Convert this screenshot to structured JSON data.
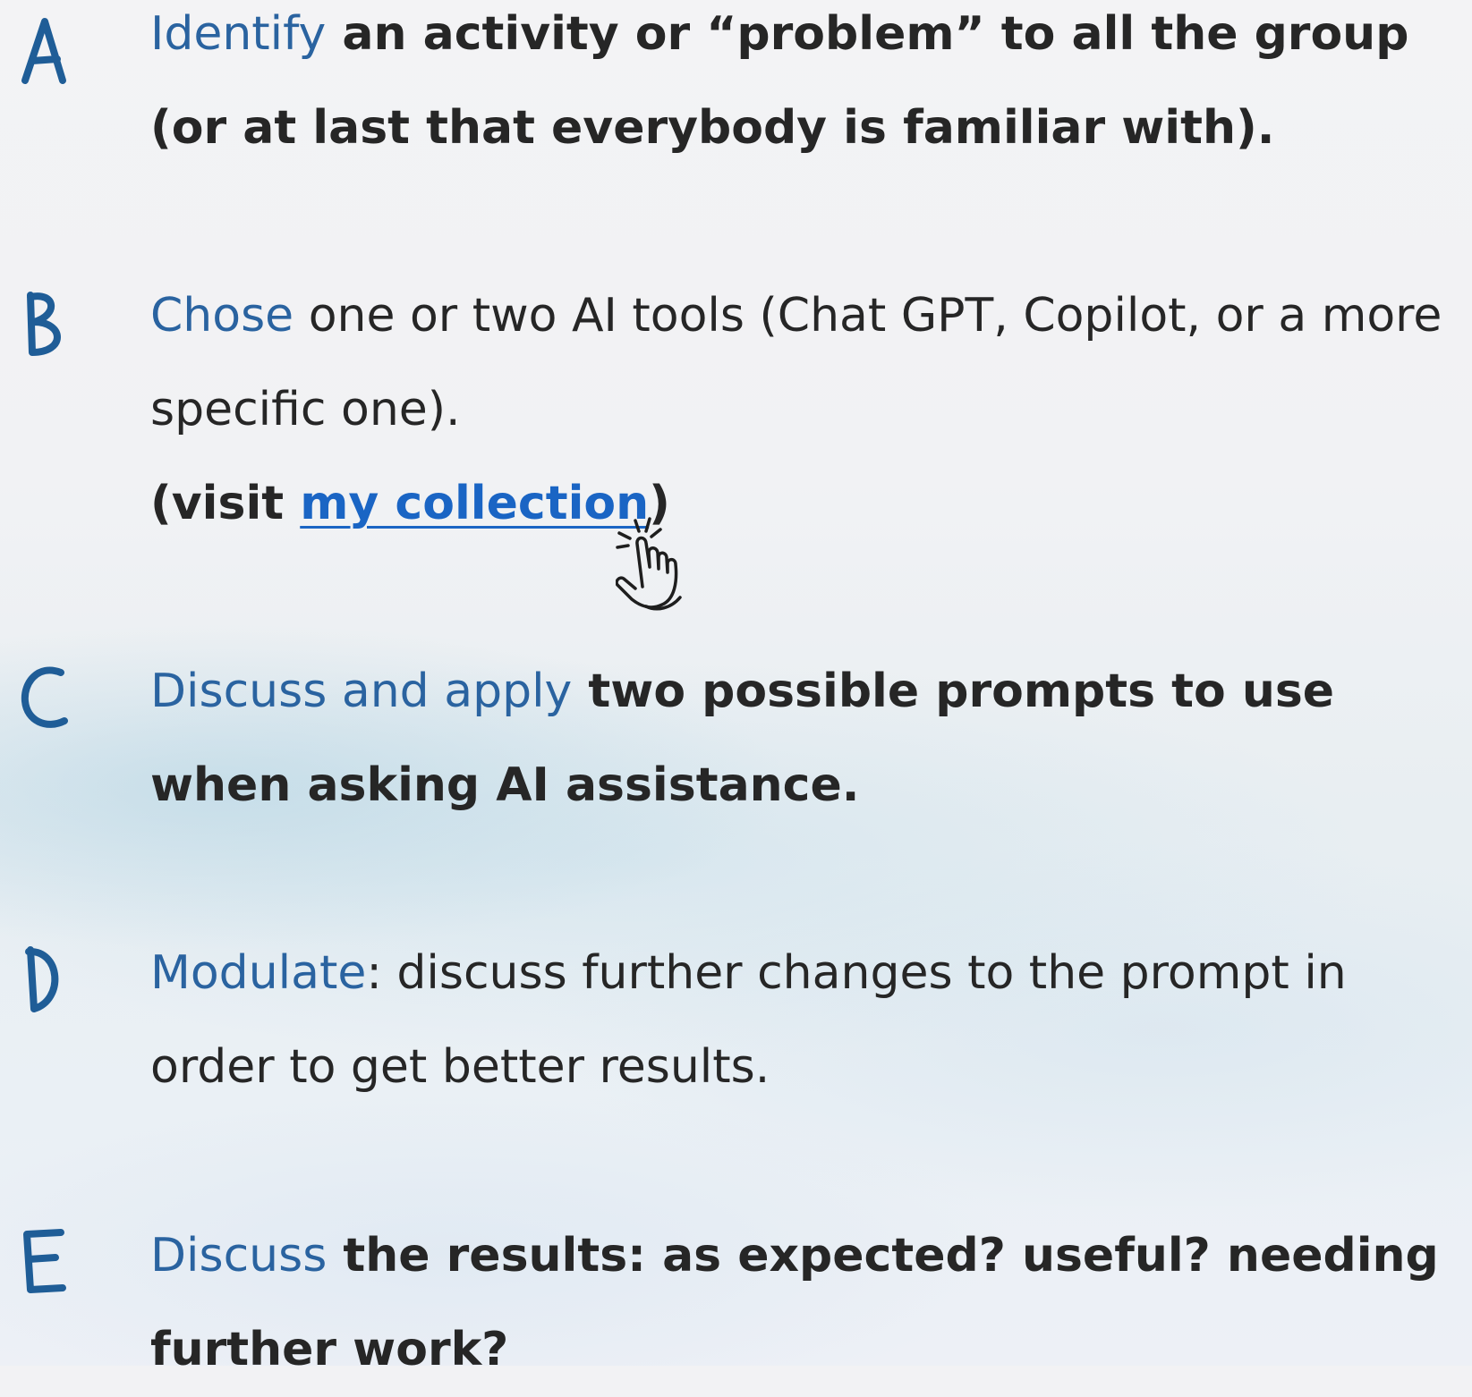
{
  "items": [
    {
      "letter": "A",
      "keyword": "Identify",
      "rest": " an activity or “problem” to all the group (or at last that everybody is familiar with)."
    },
    {
      "letter": "B",
      "keyword": "Chose",
      "rest": " one or two AI tools (Chat GPT, Copilot, or a more specific one).",
      "extra_prefix": "(visit ",
      "link_text": "my collection",
      "extra_suffix": ")"
    },
    {
      "letter": "C",
      "keyword": "Discuss and apply",
      "rest": " two possible prompts to use when asking AI assistance."
    },
    {
      "letter": "D",
      "keyword": "Modulate",
      "rest": ": discuss further changes to the prompt in order to get better results."
    },
    {
      "letter": "E",
      "keyword": "Discuss",
      "rest": " the results: as expected? useful? needing further work?"
    }
  ],
  "icons": {
    "cursor": "pointing-hand-click-icon"
  },
  "colors": {
    "keyword": "#2a63a0",
    "letter": "#1f5d97",
    "link": "#1a65c4",
    "text": "#262626"
  }
}
